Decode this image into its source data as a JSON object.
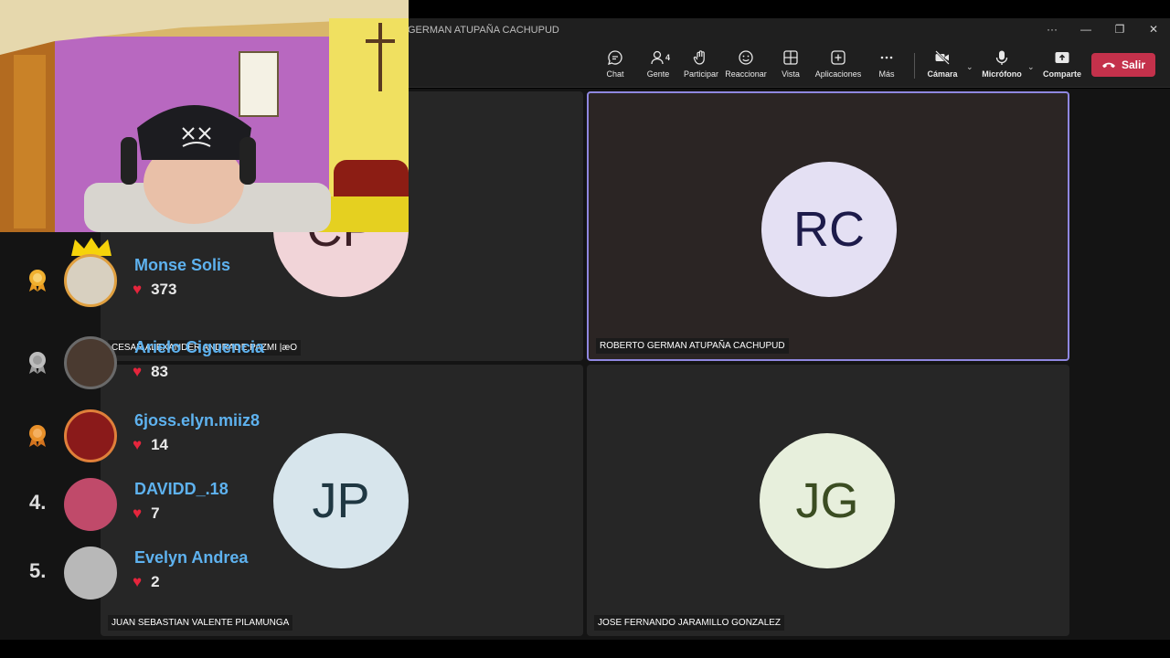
{
  "window": {
    "title": "GERMAN ATUPAÑA CACHUPUD",
    "controls": [
      "···",
      "—",
      "❐",
      "✕"
    ]
  },
  "toolbar": {
    "chat": "Chat",
    "people": "Gente",
    "people_count": "4",
    "raise": "Participar",
    "react": "Reaccionar",
    "view": "Vista",
    "apps": "Aplicaciones",
    "more": "Más",
    "camera": "Cámara",
    "mic": "Micrófono",
    "share": "Comparte",
    "leave": "Salir"
  },
  "participants": [
    {
      "initials": "CP",
      "name": "CESAR ALEXANDER ANDRADE PAZMI |æO",
      "avatar_bg": "#f1d4d8",
      "avatar_fg": "#3d1f26"
    },
    {
      "initials": "RC",
      "name": "ROBERTO GERMAN ATUPAÑA CACHUPUD",
      "avatar_bg": "#e4e0f3",
      "avatar_fg": "#1d1b4a",
      "active": true
    },
    {
      "initials": "JP",
      "name": "JUAN SEBASTIAN VALENTE PILAMUNGA",
      "avatar_bg": "#d7e5ec",
      "avatar_fg": "#1f3742"
    },
    {
      "initials": "JG",
      "name": "JOSE FERNANDO JARAMILLO GONZALEZ",
      "avatar_bg": "#e7efdc",
      "avatar_fg": "#3b4d22"
    }
  ],
  "leaderboard": [
    {
      "rank": "1",
      "user": "Monse Solis",
      "likes": "373"
    },
    {
      "rank": "2",
      "user": "Arielo Ciguencia",
      "likes": "83"
    },
    {
      "rank": "3",
      "user": "6joss.elyn.miiz8",
      "likes": "14"
    },
    {
      "rank": "4.",
      "user": "DAVIDD_.18",
      "likes": "7"
    },
    {
      "rank": "5.",
      "user": "Evelyn Andrea",
      "likes": "2"
    }
  ],
  "colors": {
    "accent": "#8f87e0",
    "leave": "#c4314b",
    "username": "#5eb2ef",
    "heart": "#e5253c"
  }
}
